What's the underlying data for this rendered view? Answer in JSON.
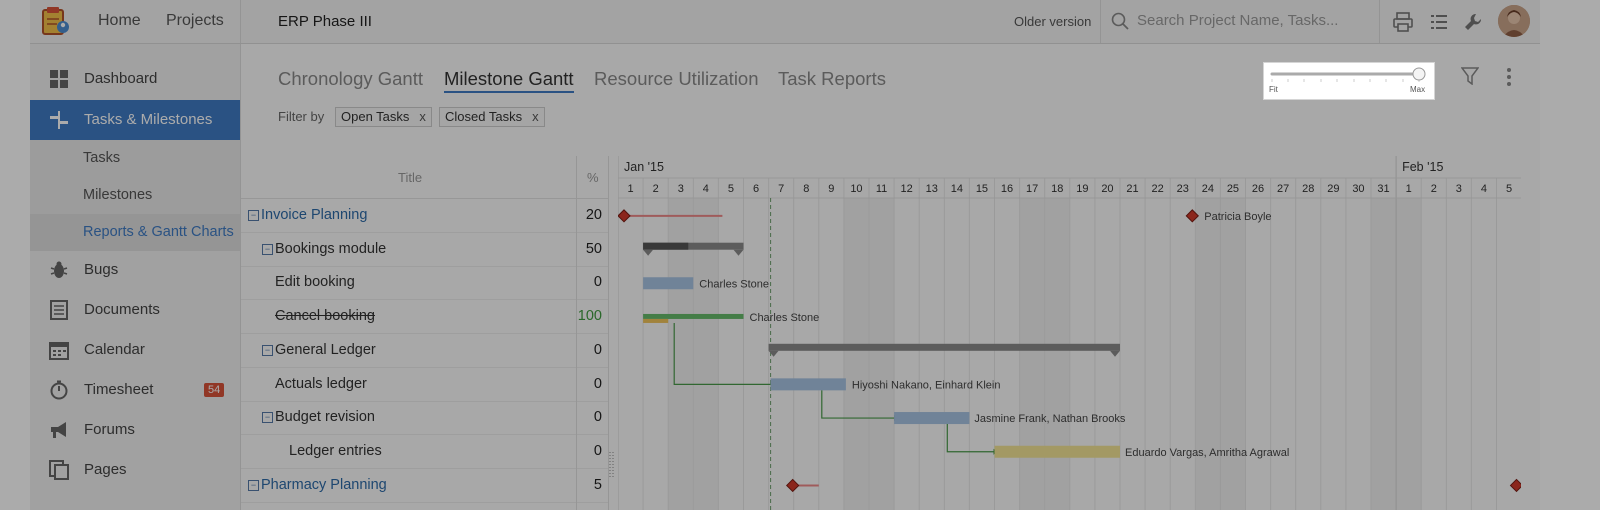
{
  "topbar": {
    "nav_home": "Home",
    "nav_projects": "Projects",
    "project_title": "ERP Phase III",
    "older_version": "Older version",
    "search_placeholder": "Search Project Name, Tasks..."
  },
  "sidebar": {
    "items": [
      {
        "label": "Dashboard",
        "icon": "dashboard-icon"
      },
      {
        "label": "Tasks & Milestones",
        "icon": "tasks-milestones-icon",
        "active": true
      },
      {
        "label": "Bugs",
        "icon": "bug-icon"
      },
      {
        "label": "Documents",
        "icon": "documents-icon"
      },
      {
        "label": "Calendar",
        "icon": "calendar-icon"
      },
      {
        "label": "Timesheet",
        "icon": "timer-icon",
        "badge": "54"
      },
      {
        "label": "Forums",
        "icon": "megaphone-icon"
      },
      {
        "label": "Pages",
        "icon": "pages-icon"
      }
    ],
    "subitems": [
      {
        "label": "Tasks"
      },
      {
        "label": "Milestones"
      },
      {
        "label": "Reports & Gantt Charts",
        "selected": true
      }
    ]
  },
  "tabs": [
    {
      "label": "Chronology Gantt"
    },
    {
      "label": "Milestone Gantt",
      "active": true
    },
    {
      "label": "Resource Utilization"
    },
    {
      "label": "Task Reports"
    }
  ],
  "filter": {
    "label": "Filter by",
    "chips": [
      {
        "label": "Open Tasks",
        "remove": "x"
      },
      {
        "label": "Closed Tasks",
        "remove": "x"
      }
    ]
  },
  "zoom": {
    "min_label": "Fit",
    "max_label": "Max",
    "level": 1.0
  },
  "table": {
    "col_title": "Title",
    "col_pct": "%",
    "rows": [
      {
        "name": "Invoice Planning",
        "pct": "20",
        "level": 0,
        "group": true
      },
      {
        "name": "Bookings module",
        "pct": "50",
        "level": 1,
        "group": true
      },
      {
        "name": "Edit booking",
        "pct": "0",
        "level": 2
      },
      {
        "name": "Cancel booking",
        "pct": "100",
        "level": 2,
        "closed": true
      },
      {
        "name": "General Ledger",
        "pct": "0",
        "level": 1,
        "group": true
      },
      {
        "name": "Actuals ledger",
        "pct": "0",
        "level": 2
      },
      {
        "name": "Budget revision",
        "pct": "0",
        "level": 2,
        "group": true
      },
      {
        "name": "Ledger entries",
        "pct": "0",
        "level": 3
      },
      {
        "name": "Pharmacy Planning",
        "pct": "5",
        "level": 0,
        "group": true
      }
    ]
  },
  "gantt": {
    "months": [
      {
        "label": "Jan '15",
        "days": 31
      },
      {
        "label": "Feb '15",
        "days": 5
      }
    ],
    "today_day": 7,
    "bar_labels": [
      {
        "row": 0,
        "text": "Patricia Boyle"
      },
      {
        "row": 2,
        "text": "Charles Stone"
      },
      {
        "row": 3,
        "text": "Charles Stone"
      },
      {
        "row": 5,
        "text": "Hiyoshi Nakano, Einhard Klein"
      },
      {
        "row": 6,
        "text": "Jasmine Frank, Nathan Brooks"
      },
      {
        "row": 7,
        "text": "Eduardo Vargas, Amritha Agrawal"
      }
    ],
    "colors": {
      "milestone": "#d0392b",
      "group_bar": "#8a8a8a",
      "task_bar": "#a7c3e3",
      "task_bar_alt": "#f3e596",
      "done_bar": "#66bb6a",
      "done_progress": "#f0c35a",
      "link_line": "#4a9a4a",
      "today_line": "#6c9f6c"
    }
  }
}
